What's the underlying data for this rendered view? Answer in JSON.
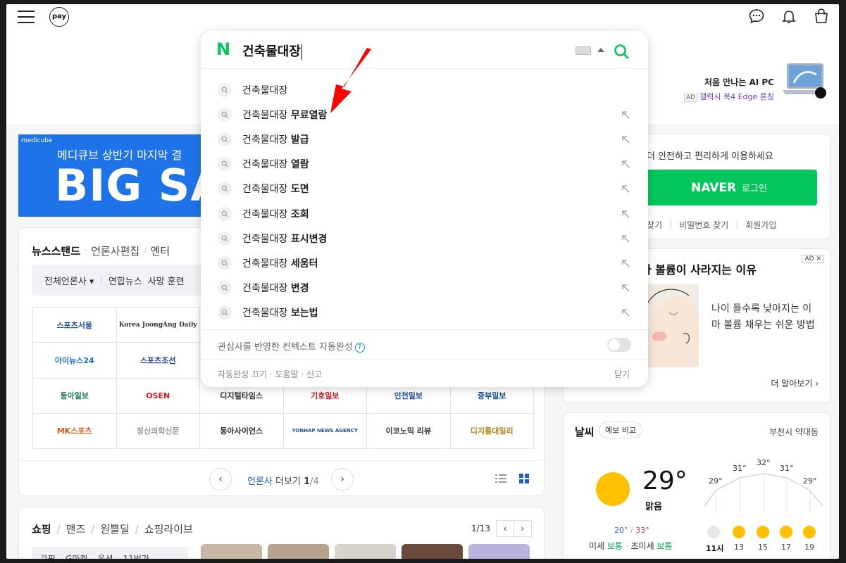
{
  "topbar": {
    "pay_label": "pay"
  },
  "ad_pc": {
    "line1": "처음 만나는 AI PC",
    "ad_tag": "AD",
    "line2": "갤럭시 북4 Edge 론칭"
  },
  "banner": {
    "brand": "medicube",
    "line1": "메디큐브 상반기 마지막 결",
    "big": "BIG SA"
  },
  "newsstand": {
    "tabs": [
      "뉴스스탠드",
      "언론사편집",
      "엔터"
    ],
    "filter": [
      "전체언론사 ▾",
      "연합뉴스",
      "사망 훈련"
    ],
    "publishers": [
      "스포츠서울",
      "Korea JoongAng Daily",
      "",
      "",
      "",
      "",
      "아이뉴스24",
      "스포츠조선",
      "",
      "",
      "",
      "",
      "동아일보",
      "OSEN",
      "디지털타임스",
      "기호일보",
      "인천일보",
      "중부일보",
      "MK스포츠",
      "정신의학신문",
      "동아사이언스",
      "YONHAP NEWS AGENCY",
      "이코노믹 리뷰",
      "디지틀대일리"
    ],
    "pager_blue": "언론사",
    "pager_text": " 더보기 ",
    "pager_page": "1",
    "pager_total": "/4"
  },
  "shopping": {
    "tabs": [
      "쇼핑",
      "맨즈",
      "원쁠딜",
      "쇼핑라이브"
    ],
    "page": "1/13",
    "cats": [
      "쿠팡",
      "G마켓",
      "옥션",
      "11번가"
    ]
  },
  "login": {
    "message": "더 안전하고 편리하게 이용하세요",
    "naver": "NAVER",
    "login_label": "로그인",
    "links": [
      "찾기",
      "비밀번호 찾기",
      "회원가입"
    ]
  },
  "ad_box": {
    "ad_tag": "AD",
    "close": "✕",
    "title": "마 볼륨이 사라지는 이유",
    "desc": "나이 들수록 낮아지는 이마 볼륨 채우는 쉬운 방법",
    "more": "더 알아보기"
  },
  "weather": {
    "title": "날씨",
    "compare": "예보 비교",
    "location": "부천시 약대동",
    "temp": "29°",
    "condition": "맑음",
    "low": "20°",
    "high": "33°",
    "dust_label": "미세",
    "dust_value": "보통",
    "ultra_label": "초미세",
    "ultra_value": "보통",
    "hourly_temps": [
      "29°",
      "31°",
      "32°",
      "31°",
      "29°"
    ],
    "hours": [
      "11시",
      "13",
      "15",
      "17",
      "19"
    ]
  },
  "search": {
    "query": "건축물대장",
    "suggestions": [
      {
        "base": "건축물대장",
        "extra": ""
      },
      {
        "base": "건축물대장 ",
        "extra": "무료열람"
      },
      {
        "base": "건축물대장 ",
        "extra": "발급"
      },
      {
        "base": "건축물대장 ",
        "extra": "열람"
      },
      {
        "base": "건축물대장 ",
        "extra": "도면"
      },
      {
        "base": "건축물대장 ",
        "extra": "조회"
      },
      {
        "base": "건축물대장 ",
        "extra": "표시변경"
      },
      {
        "base": "건축물대장 ",
        "extra": "세움터"
      },
      {
        "base": "건축물대장 ",
        "extra": "변경"
      },
      {
        "base": "건축물대장 ",
        "extra": "보는법"
      }
    ],
    "context_text": "관심사를 반영한 컨텍스트 자동완성",
    "help_mark": "?",
    "footer_left": "자동완성 끄기 · 도움말 · 신고",
    "footer_right": "닫기"
  },
  "colors": {
    "naver_green": "#03c75a",
    "annotation_red": "#ff0000"
  }
}
